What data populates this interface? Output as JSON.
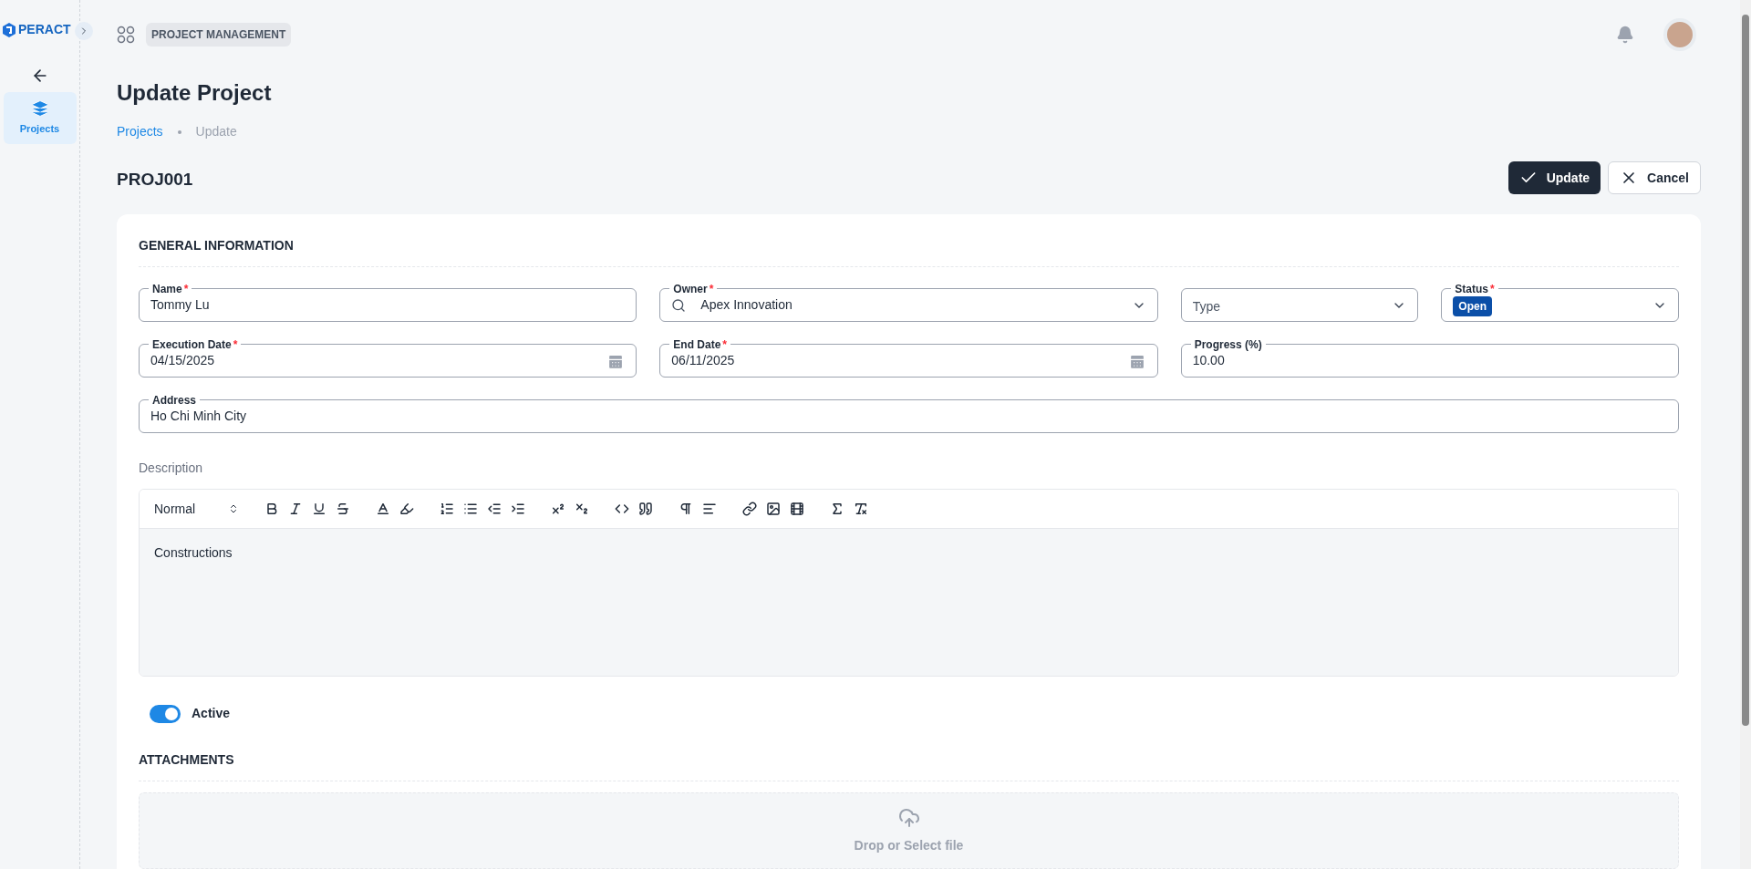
{
  "sidebar": {
    "logo": "PERACT",
    "items": [
      {
        "label": "Projects",
        "selected": true
      }
    ]
  },
  "header": {
    "module": "PROJECT MANAGEMENT"
  },
  "page": {
    "title": "Update Project",
    "breadcrumb": [
      {
        "label": "Projects",
        "kind": "link"
      },
      {
        "label": "Update",
        "kind": "current"
      }
    ],
    "code": "PROJ001",
    "actions": [
      {
        "label": "Update",
        "kind": "primary"
      },
      {
        "label": "Cancel",
        "kind": "secondary"
      }
    ]
  },
  "general": {
    "title": "GENERAL INFORMATION",
    "fields": [
      {
        "kind": "text",
        "label": "Name",
        "required": "*",
        "value": "Tommy Lu"
      },
      {
        "kind": "search-select",
        "label": "Owner",
        "required": "*",
        "value": "Apex Innovation"
      },
      {
        "kind": "select",
        "placeholder": "Type"
      },
      {
        "kind": "badge-select",
        "label": "Status",
        "required": "*",
        "value": "Open"
      },
      {
        "kind": "date",
        "label": "Execution Date",
        "required": "*",
        "value": "04/15/2025"
      },
      {
        "kind": "date",
        "label": "End Date",
        "required": "*",
        "value": "06/11/2025"
      },
      {
        "kind": "text",
        "label": "Progress (%)",
        "value": "10.00"
      },
      {
        "kind": "text",
        "label": "Address",
        "value": "Ho Chi Minh City"
      }
    ]
  },
  "description": {
    "label": "Description",
    "format": "Normal",
    "content": "Constructions"
  },
  "active": {
    "label": "Active",
    "on": true
  },
  "attachments": {
    "title": "ATTACHMENTS",
    "dropzone": "Drop or Select file"
  }
}
